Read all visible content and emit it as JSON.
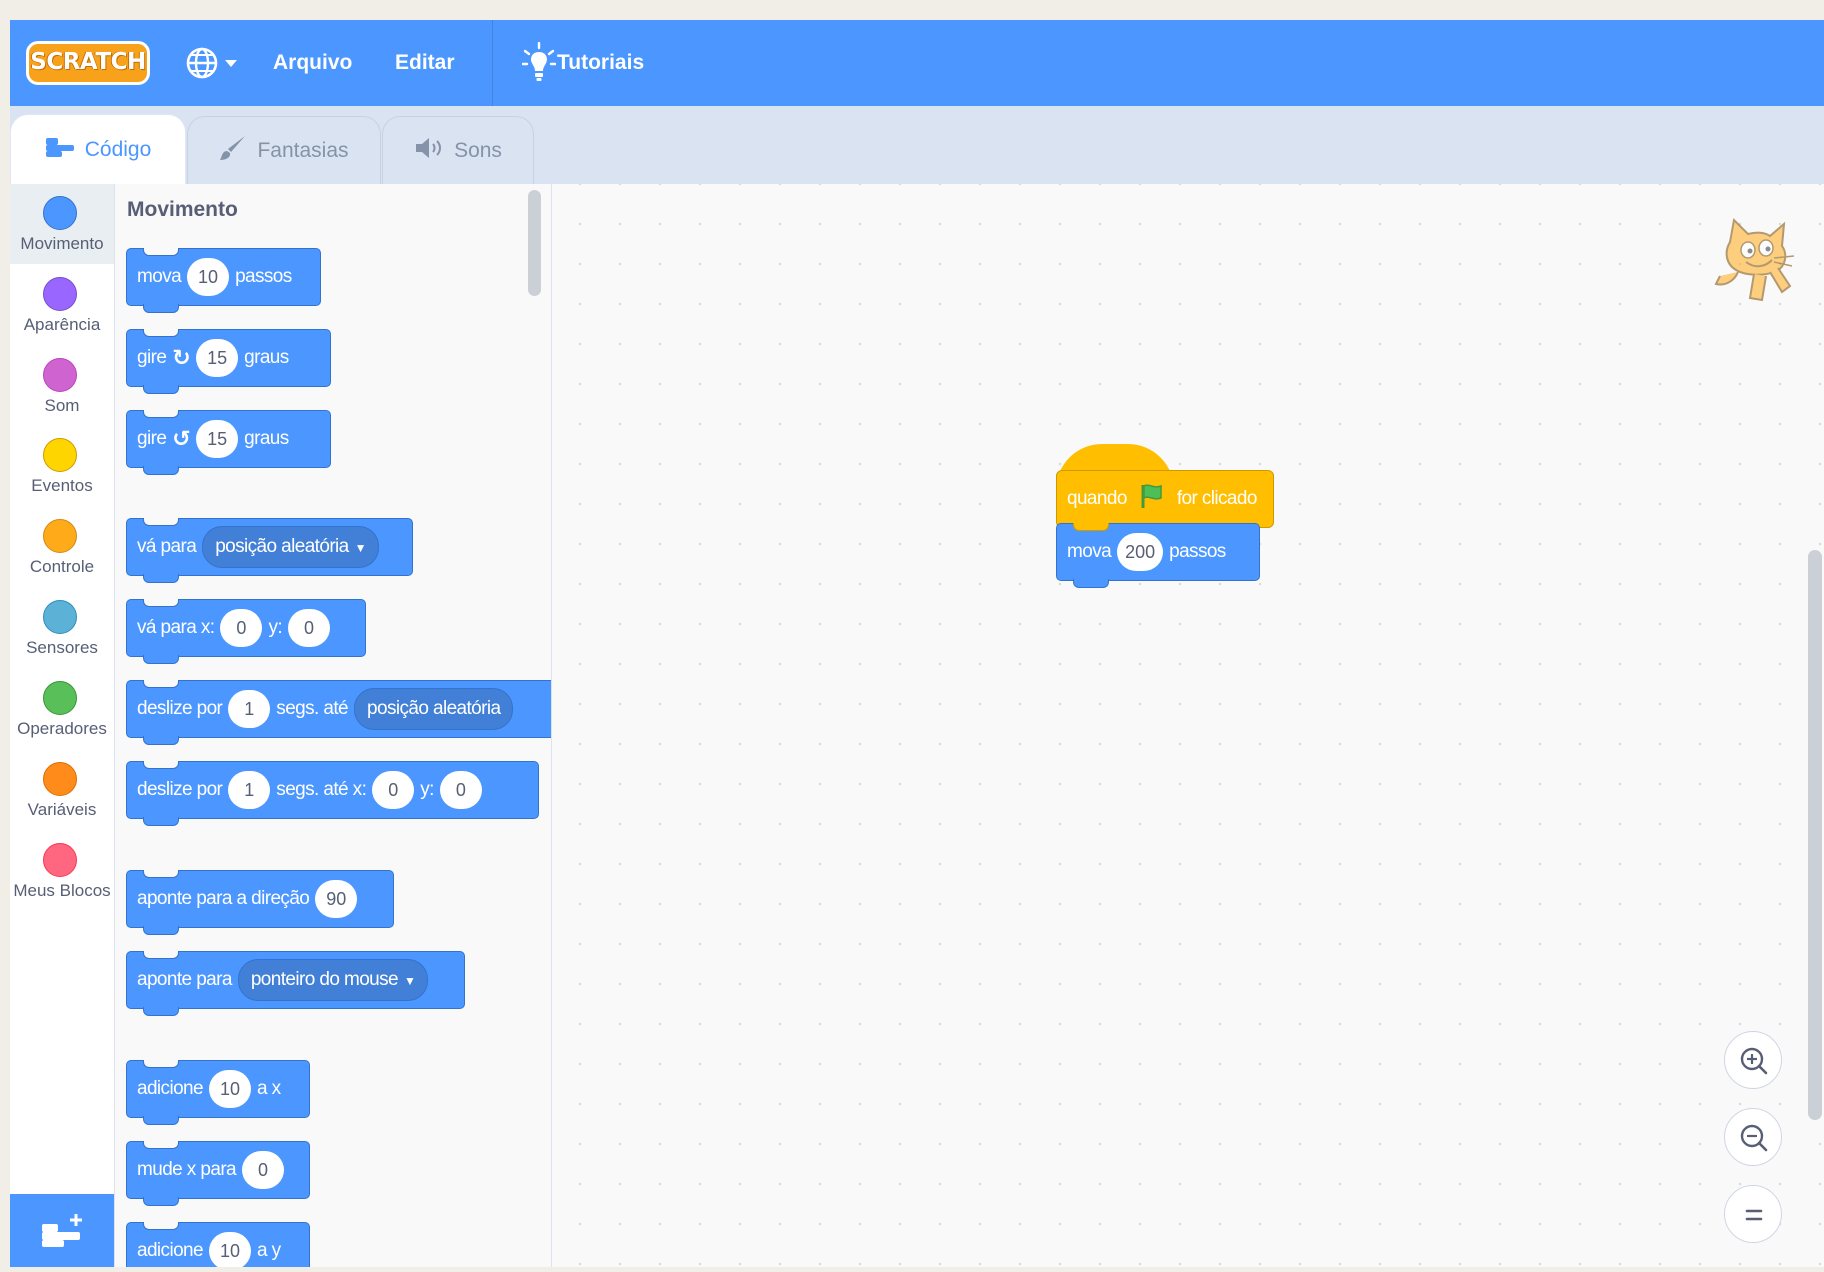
{
  "app": {
    "logo_text": "SCRATCH"
  },
  "menubar": {
    "language_icon": "globe-icon",
    "file": "Arquivo",
    "edit": "Editar",
    "tutorials": "Tutoriais",
    "tutorials_icon": "lightbulb-icon"
  },
  "tabs": [
    {
      "label": "Código",
      "icon": "code-icon",
      "active": true
    },
    {
      "label": "Fantasias",
      "icon": "paintbrush-icon",
      "active": false
    },
    {
      "label": "Sons",
      "icon": "speaker-icon",
      "active": false
    }
  ],
  "categories": [
    {
      "label": "Movimento",
      "color": "#4c97ff"
    },
    {
      "label": "Aparência",
      "color": "#9966ff"
    },
    {
      "label": "Som",
      "color": "#cf63cf"
    },
    {
      "label": "Eventos",
      "color": "#ffd500"
    },
    {
      "label": "Controle",
      "color": "#ffab19"
    },
    {
      "label": "Sensores",
      "color": "#5cb1d6"
    },
    {
      "label": "Operadores",
      "color": "#59c059"
    },
    {
      "label": "Variáveis",
      "color": "#ff8c1a"
    },
    {
      "label": "Meus Blocos",
      "color": "#ff6680"
    }
  ],
  "palette": {
    "title": "Movimento",
    "blocks": {
      "move": {
        "t1": "mova",
        "v1": "10",
        "t2": "passos"
      },
      "turn_right": {
        "t1": "gire",
        "v1": "15",
        "t2": "graus"
      },
      "turn_left": {
        "t1": "gire",
        "v1": "15",
        "t2": "graus"
      },
      "goto": {
        "t1": "vá para",
        "d1": "posição aleatória"
      },
      "goto_xy": {
        "t1": "vá para x:",
        "v1": "0",
        "t2": "y:",
        "v2": "0"
      },
      "glide_to": {
        "t1": "deslize por",
        "v1": "1",
        "t2": "segs. até",
        "d1": "posição aleatória"
      },
      "glide_xy": {
        "t1": "deslize por",
        "v1": "1",
        "t2": "segs. até x:",
        "v2": "0",
        "t3": "y:",
        "v3": "0"
      },
      "point_dir": {
        "t1": "aponte  para a direção",
        "v1": "90"
      },
      "point_towards": {
        "t1": "aponte para",
        "d1": "ponteiro do mouse"
      },
      "change_x": {
        "t1": "adicione",
        "v1": "10",
        "t2": "a x"
      },
      "set_x": {
        "t1": "mude x para",
        "v1": "0"
      },
      "change_y": {
        "t1": "adicione",
        "v1": "10",
        "t2": "a y"
      }
    }
  },
  "workspace": {
    "hat": {
      "t1": "quando",
      "t2": "for clicado",
      "flag_icon": "green-flag-icon",
      "color": "#ffbf00"
    },
    "move": {
      "t1": "mova",
      "v1": "200",
      "t2": "passos"
    },
    "zoom_in_icon": "zoom-in-icon",
    "zoom_out_icon": "zoom-out-icon",
    "reset_icon": "zoom-reset-icon"
  },
  "colors": {
    "menubar": "#4c97ff",
    "motion": "#4c97ff",
    "events": "#ffbf00"
  }
}
